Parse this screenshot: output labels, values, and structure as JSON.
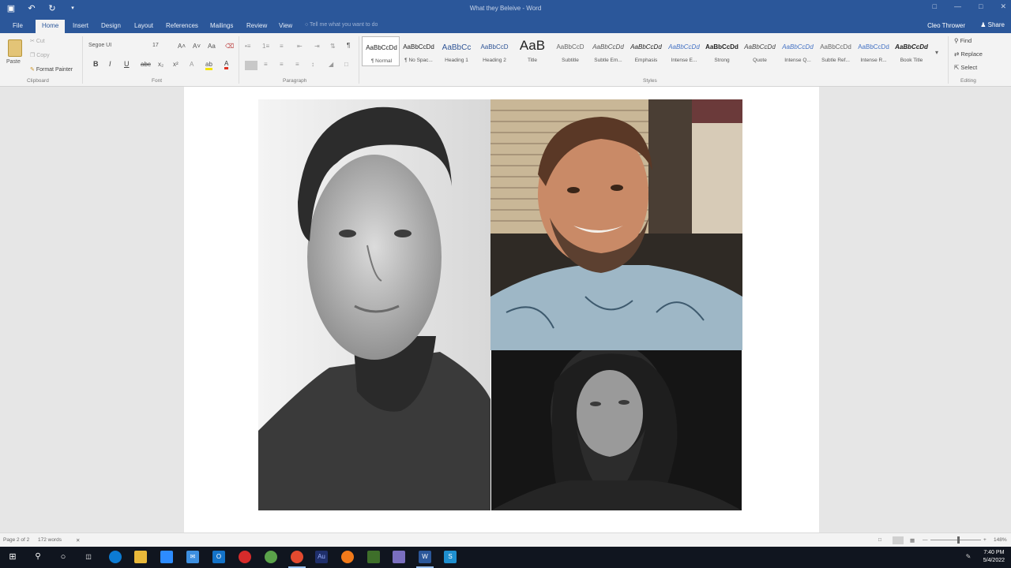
{
  "window": {
    "doc_title": "What they Beleive - Word",
    "user": "Cleo Thrower",
    "share_label": "Share"
  },
  "tabs": [
    {
      "label": "File"
    },
    {
      "label": "Home"
    },
    {
      "label": "Insert"
    },
    {
      "label": "Design"
    },
    {
      "label": "Layout"
    },
    {
      "label": "References"
    },
    {
      "label": "Mailings"
    },
    {
      "label": "Review"
    },
    {
      "label": "View"
    }
  ],
  "tell_me": "Tell me what you want to do",
  "clipboard": {
    "paste": "Paste",
    "cut": "Cut",
    "copy": "Copy",
    "format_painter": "Format Painter",
    "group_label": "Clipboard"
  },
  "font": {
    "name": "Segoe UI",
    "size": "17",
    "group_label": "Font"
  },
  "paragraph": {
    "group_label": "Paragraph"
  },
  "styles": {
    "group_label": "Styles",
    "items": [
      {
        "sample": "AaBbCcDd",
        "name": "¶ Normal"
      },
      {
        "sample": "AaBbCcDd",
        "name": "¶ No Spac..."
      },
      {
        "sample": "AaBbCc",
        "name": "Heading 1"
      },
      {
        "sample": "AaBbCcD",
        "name": "Heading 2"
      },
      {
        "sample": "AaB",
        "name": "Title"
      },
      {
        "sample": "AaBbCcD",
        "name": "Subtitle"
      },
      {
        "sample": "AaBbCcDd",
        "name": "Subtle Em..."
      },
      {
        "sample": "AaBbCcDd",
        "name": "Emphasis"
      },
      {
        "sample": "AaBbCcDd",
        "name": "Intense E..."
      },
      {
        "sample": "AaBbCcDd",
        "name": "Strong"
      },
      {
        "sample": "AaBbCcDd",
        "name": "Quote"
      },
      {
        "sample": "AaBbCcDd",
        "name": "Intense Q..."
      },
      {
        "sample": "AaBbCcDd",
        "name": "Subtle Ref..."
      },
      {
        "sample": "AaBbCcDd",
        "name": "Intense R..."
      },
      {
        "sample": "AaBbCcDd",
        "name": "Book Title"
      }
    ]
  },
  "editing": {
    "find": "Find",
    "replace": "Replace",
    "select": "Select",
    "group_label": "Editing"
  },
  "status": {
    "page": "Page 2 of 2",
    "words": "172 words",
    "zoom": "148%",
    "zoom_level": 0.55
  },
  "clock": {
    "time": "7:40 PM",
    "date": "5/4/2022"
  },
  "colors": {
    "ribbon_blue": "#2b579a",
    "font_color_red": "#e03020",
    "highlight_yellow": "#f5e400"
  }
}
